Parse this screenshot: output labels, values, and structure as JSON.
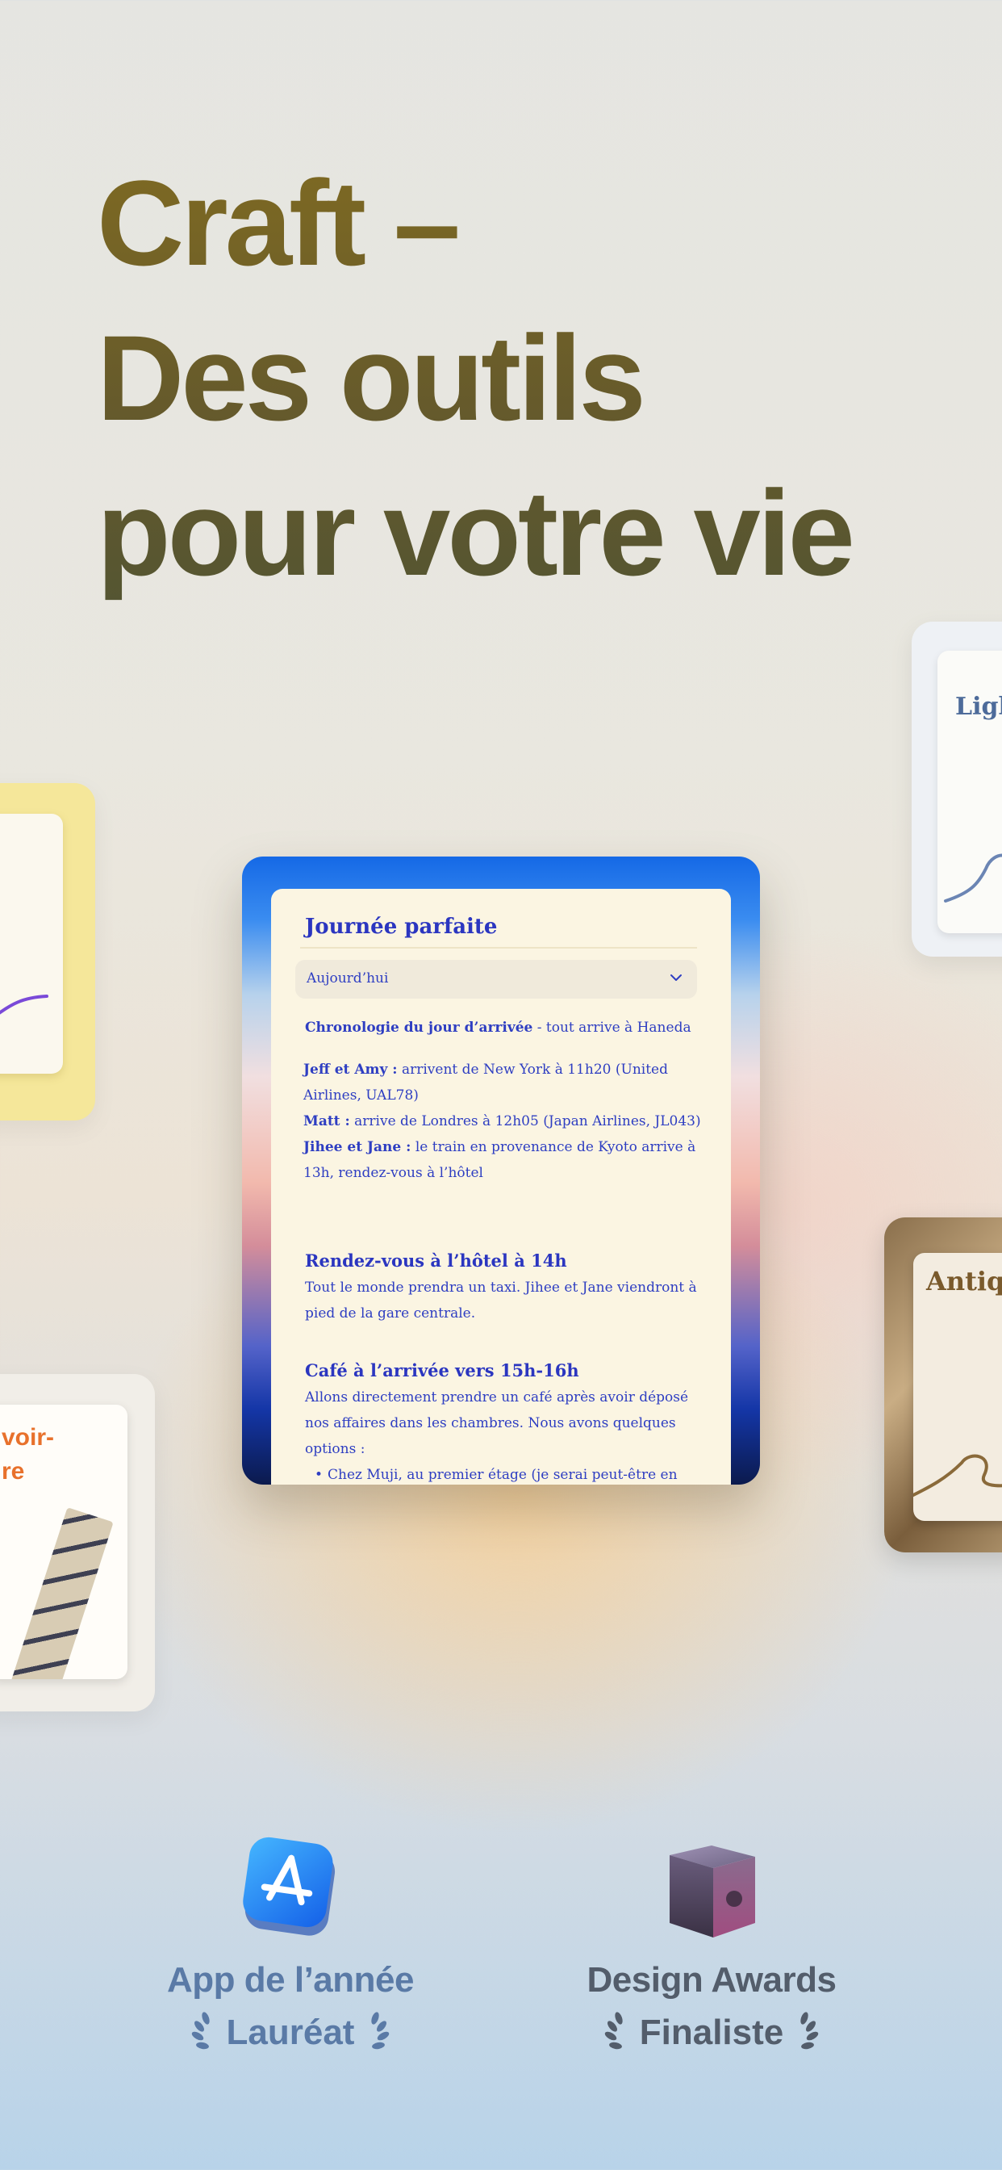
{
  "headline": {
    "lines": [
      "Craft –",
      "Des outils",
      "pour votre vie"
    ]
  },
  "side_cards": {
    "blue_label": "Ligh",
    "white_label": "voir-\nre",
    "antique_label": "Antiq"
  },
  "document": {
    "title": "Journée parfaite",
    "dropdown_value": "Aujourd’hui",
    "timeline_bold": "Chronologie du jour d’arrivée",
    "timeline_rest": " - tout arrive à Haneda",
    "jeff_bold": "Jeff et Amy :",
    "jeff_rest": " arrivent de New York à 11h20 (United Airlines, UAL78)",
    "matt_bold": "Matt :",
    "matt_rest": " arrive de Londres à 12h05 (Japan Airlines, JL043)",
    "jihee_bold": "Jihee et Jane :",
    "jihee_rest": " le train en provenance de Kyoto arrive à 13h, rendez-vous à l’hôtel",
    "section1_heading": "Rendez-vous à l’hôtel à 14h",
    "section1_text": "Tout le monde prendra un taxi. Jihee et Jane viendront à pied de la gare centrale.",
    "section2_heading": "Café à l’arrivée vers 15h-16h",
    "section2_text": "Allons directement prendre un café après avoir déposé nos affaires dans les chambres. Nous avons quelques options :",
    "bullet1": "Chez Muji, au premier étage (je serai peut-être en mode zombie à cause du décalage horaire, donc pas"
  },
  "awards": [
    {
      "icon": "app-store-icon",
      "title": "App de l’année",
      "subtitle": "Lauréat",
      "color": "#5a7aa6"
    },
    {
      "icon": "apple-design-award-cube-icon",
      "title": "Design Awards",
      "subtitle": "Finaliste",
      "color": "#535d6b"
    }
  ]
}
